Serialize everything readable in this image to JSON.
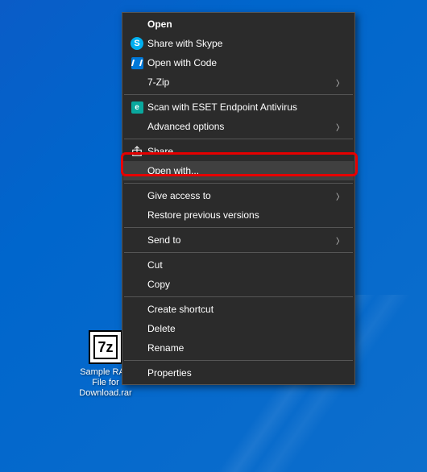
{
  "desktop": {
    "file": {
      "icon_text": "7z",
      "label": "Sample RAR File for Download.rar"
    }
  },
  "menu": {
    "open": "Open",
    "share_skype": "Share with Skype",
    "open_code": "Open with Code",
    "seven_zip": "7-Zip",
    "eset_scan": "Scan with ESET Endpoint Antivirus",
    "advanced_options": "Advanced options",
    "share": "Share",
    "open_with": "Open with...",
    "give_access": "Give access to",
    "restore_versions": "Restore previous versions",
    "send_to": "Send to",
    "cut": "Cut",
    "copy": "Copy",
    "create_shortcut": "Create shortcut",
    "delete": "Delete",
    "rename": "Rename",
    "properties": "Properties"
  }
}
